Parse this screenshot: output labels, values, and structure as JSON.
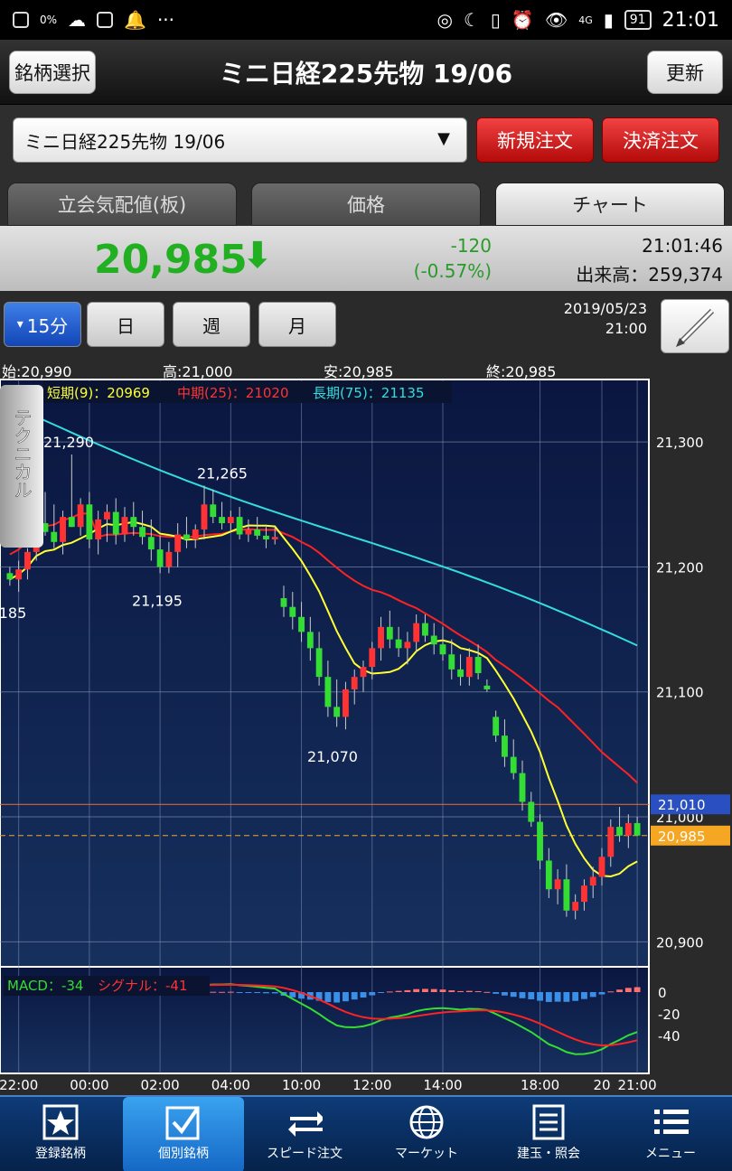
{
  "status_bar": {
    "time": "21:01",
    "battery": "91",
    "signal": "4G",
    "data_rate": "0%"
  },
  "header": {
    "left_button": "銘柄選択",
    "title": "ミニ日経225先物 19/06",
    "right_button": "更新"
  },
  "selector": {
    "value": "ミニ日経225先物 19/06",
    "arrow": "▼",
    "new_order": "新規注文",
    "close_order": "決済注文"
  },
  "tabs": [
    {
      "label": "立会気配値(板)",
      "active": false
    },
    {
      "label": "価格",
      "active": false
    },
    {
      "label": "チャート",
      "active": true
    }
  ],
  "quote": {
    "price": "20,985",
    "change": "-120",
    "change_pct": "(-0.57%)",
    "time": "21:01:46",
    "volume": "出来高：259,374"
  },
  "periods": [
    {
      "label": "15分",
      "active": true,
      "icon": "▾"
    },
    {
      "label": "日",
      "active": false
    },
    {
      "label": "週",
      "active": false
    },
    {
      "label": "月",
      "active": false
    }
  ],
  "chart_date": "2019/05/23",
  "chart_time": "21:00",
  "ohlc": {
    "open": "始:20,990",
    "high": "高:21,000",
    "low": "安:20,985",
    "close": "終:20,985"
  },
  "technical_label": "テクニカル",
  "colors": {
    "short_ma": "#ffff33",
    "mid_ma": "#ff2222",
    "long_ma": "#33dddd",
    "up": "#ff3333",
    "down": "#33dd33",
    "chart_bg": "#0c1a44"
  },
  "chart_data": {
    "type": "candlestick",
    "legend": {
      "short": "短期(9)：20969",
      "mid": "中期(25)：21020",
      "long": "長期(75)：21135"
    },
    "y_ticks": [
      "21,300",
      "21,200",
      "21,100",
      "21,000",
      "20,900"
    ],
    "ylim": [
      20880,
      21350
    ],
    "x_ticks": [
      "22:00",
      "00:00",
      "02:00",
      "04:00",
      "10:00",
      "12:00",
      "14:00",
      "18:00",
      "20",
      "21:00"
    ],
    "annotations": [
      {
        "text": "21,290",
        "value": 21290
      },
      {
        "text": "21,265",
        "value": 21265
      },
      {
        "text": "21,195",
        "value": 21195
      },
      {
        "text": "185",
        "value": 21185
      },
      {
        "text": "21,070",
        "value": 21070
      }
    ],
    "price_tags": [
      {
        "text": "21,010",
        "value": 21010,
        "color": "#2a4fc0"
      },
      {
        "text": "20,985",
        "value": 20985,
        "color": "#f5a623"
      }
    ],
    "candles": [
      [
        21195,
        21200,
        21185,
        21190
      ],
      [
        21190,
        21205,
        21180,
        21198
      ],
      [
        21198,
        21215,
        21190,
        21212
      ],
      [
        21212,
        21240,
        21205,
        21235
      ],
      [
        21235,
        21260,
        21225,
        21228
      ],
      [
        21228,
        21250,
        21215,
        21220
      ],
      [
        21220,
        21245,
        21210,
        21240
      ],
      [
        21240,
        21290,
        21232,
        21232
      ],
      [
        21232,
        21255,
        21225,
        21250
      ],
      [
        21250,
        21260,
        21215,
        21222
      ],
      [
        21222,
        21245,
        21210,
        21238
      ],
      [
        21238,
        21250,
        21220,
        21244
      ],
      [
        21244,
        21255,
        21218,
        21226
      ],
      [
        21226,
        21248,
        21220,
        21240
      ],
      [
        21240,
        21252,
        21225,
        21232
      ],
      [
        21232,
        21245,
        21218,
        21224
      ],
      [
        21224,
        21238,
        21205,
        21214
      ],
      [
        21214,
        21225,
        21195,
        21200
      ],
      [
        21200,
        21220,
        21195,
        21212
      ],
      [
        21212,
        21235,
        21200,
        21226
      ],
      [
        21226,
        21240,
        21215,
        21222
      ],
      [
        21222,
        21234,
        21215,
        21230
      ],
      [
        21230,
        21265,
        21222,
        21250
      ],
      [
        21250,
        21262,
        21235,
        21240
      ],
      [
        21240,
        21252,
        21230,
        21235
      ],
      [
        21235,
        21245,
        21228,
        21240
      ],
      [
        21240,
        21248,
        21222,
        21226
      ],
      [
        21226,
        21238,
        21220,
        21230
      ],
      [
        21230,
        21240,
        21222,
        21225
      ],
      [
        21225,
        21232,
        21215,
        21222
      ],
      [
        21222,
        21232,
        21218,
        21224
      ],
      [
        21175,
        21185,
        21160,
        21168
      ],
      [
        21168,
        21180,
        21150,
        21160
      ],
      [
        21160,
        21172,
        21140,
        21148
      ],
      [
        21148,
        21160,
        21125,
        21135
      ],
      [
        21135,
        21148,
        21105,
        21112
      ],
      [
        21112,
        21125,
        21080,
        21088
      ],
      [
        21088,
        21110,
        21072,
        21080
      ],
      [
        21080,
        21108,
        21070,
        21102
      ],
      [
        21102,
        21118,
        21090,
        21112
      ],
      [
        21112,
        21125,
        21100,
        21120
      ],
      [
        21120,
        21140,
        21110,
        21135
      ],
      [
        21135,
        21160,
        21125,
        21152
      ],
      [
        21152,
        21165,
        21135,
        21142
      ],
      [
        21142,
        21152,
        21128,
        21135
      ],
      [
        21135,
        21148,
        21122,
        21140
      ],
      [
        21140,
        21162,
        21132,
        21155
      ],
      [
        21155,
        21162,
        21140,
        21145
      ],
      [
        21145,
        21155,
        21130,
        21138
      ],
      [
        21138,
        21152,
        21125,
        21130
      ],
      [
        21130,
        21142,
        21110,
        21118
      ],
      [
        21118,
        21130,
        21105,
        21112
      ],
      [
        21112,
        21135,
        21105,
        21128
      ],
      [
        21128,
        21138,
        21110,
        21115
      ],
      [
        21105,
        21110,
        21100,
        21102
      ],
      [
        21080,
        21085,
        21060,
        21065
      ],
      [
        21065,
        21078,
        21040,
        21048
      ],
      [
        21048,
        21062,
        21030,
        21035
      ],
      [
        21035,
        21045,
        21005,
        21012
      ],
      [
        21012,
        21020,
        20992,
        20996
      ],
      [
        20996,
        21002,
        20958,
        20965
      ],
      [
        20965,
        20975,
        20935,
        20942
      ],
      [
        20942,
        20958,
        20930,
        20950
      ],
      [
        20950,
        20962,
        20920,
        20925
      ],
      [
        20925,
        20938,
        20918,
        20932
      ],
      [
        20932,
        20950,
        20925,
        20945
      ],
      [
        20945,
        20960,
        20935,
        20952
      ],
      [
        20952,
        20975,
        20945,
        20968
      ],
      [
        20968,
        20998,
        20960,
        20992
      ],
      [
        20992,
        21008,
        20980,
        20985
      ],
      [
        20985,
        21002,
        20975,
        20995
      ],
      [
        20995,
        21000,
        20985,
        20985
      ]
    ],
    "macd": {
      "label": "MACD：-34",
      "signal_label": "シグナル：-41",
      "y_ticks": [
        "0",
        "-20",
        "-40"
      ]
    }
  },
  "nav": [
    {
      "label": "登録銘柄",
      "icon": "star-icon",
      "active": false
    },
    {
      "label": "個別銘柄",
      "icon": "checkbox-icon",
      "active": true
    },
    {
      "label": "スピード注文",
      "icon": "arrows-icon",
      "active": false
    },
    {
      "label": "マーケット",
      "icon": "globe-icon",
      "active": false
    },
    {
      "label": "建玉・照会",
      "icon": "document-icon",
      "active": false
    },
    {
      "label": "メニュー",
      "icon": "menu-icon",
      "active": false
    }
  ]
}
